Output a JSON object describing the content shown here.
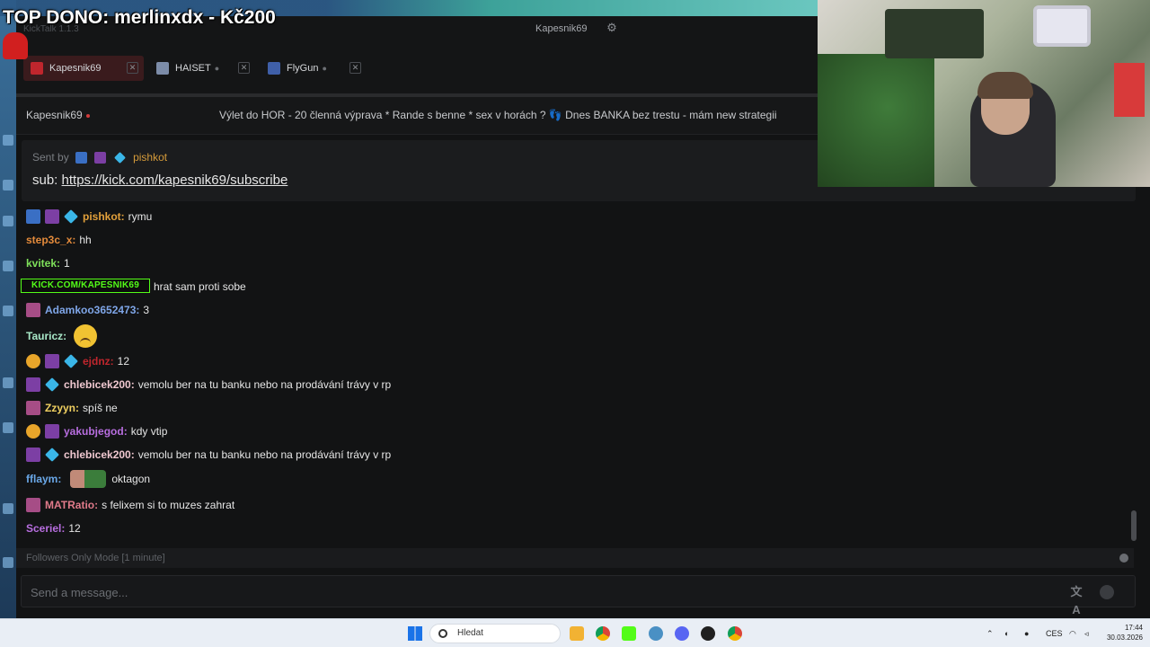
{
  "app": {
    "name": "KickTalk 1.1.3"
  },
  "stream_overlay": {
    "top_dono": "TOP DONO: merlinxdx - Kč200"
  },
  "topbar": {
    "current_user": "Kapesnik69"
  },
  "tabs": [
    {
      "label": "Kapesnik69",
      "active": true,
      "avatar_color": "#c0262d"
    },
    {
      "label": "HAISET",
      "active": false,
      "avatar_color": "#7c8ca8"
    },
    {
      "label": "FlyGun",
      "active": false,
      "avatar_color": "#3f5fa8"
    }
  ],
  "channel": {
    "name": "Kapesnik69",
    "stream_title": "Výlet do HOR - 20 členná výprava * Rande s benne * sex v horách ? 👣 Dnes BANKA bez trestu - mám new strategii"
  },
  "pinned": {
    "sent_by_prefix": "Sent by",
    "sender": "pishkot",
    "message_prefix": "sub:",
    "link": "https://kick.com/kapesnik69/subscribe"
  },
  "chat": {
    "kick_banner": "KICK.COM/KAPESNIK69",
    "messages": [
      {
        "user": "pishkot",
        "color": "#e3a13b",
        "text": "rymu"
      },
      {
        "user": "step3c_x",
        "color": "#e38a3b",
        "text": "hh"
      },
      {
        "user": "kvitek",
        "color": "#7ee05a",
        "text": "1"
      },
      {
        "user": "",
        "color": "#e6e6e6",
        "text": "hrat sam proti sobe"
      },
      {
        "user": "Adamkoo3652473",
        "color": "#7fa6e8",
        "text": "3"
      },
      {
        "user": "Tauricz",
        "color": "#a8e8c8",
        "text": ""
      },
      {
        "user": "ejdnz",
        "color": "#c0262d",
        "text": "12"
      },
      {
        "user": "chlebicek200",
        "color": "#f0c8d0",
        "text": "vemolu ber na tu banku nebo na prodávání trávy v rp"
      },
      {
        "user": "Zzyyn",
        "color": "#f0d060",
        "text": "spíš ne"
      },
      {
        "user": "yakubjegod",
        "color": "#b86ee0",
        "text": "kdy vtip"
      },
      {
        "user": "chlebicek200",
        "color": "#f0c8d0",
        "text": "vemolu ber na tu banku nebo na prodávání trávy v rp"
      },
      {
        "user": "fflaym",
        "color": "#6aa8e8",
        "text": "oktagon"
      },
      {
        "user": "MATRatio",
        "color": "#e07a8a",
        "text": "s felixem si to muzes zahrat"
      },
      {
        "user": "Sceriel",
        "color": "#b86ee0",
        "text": "12"
      }
    ]
  },
  "followers_mode": "Followers Only Mode [1 minute]",
  "input": {
    "placeholder": "Send a message..."
  },
  "taskbar": {
    "search_placeholder": "Hledat",
    "language": "CES",
    "time": "17:44",
    "date": "30.03.2026"
  }
}
